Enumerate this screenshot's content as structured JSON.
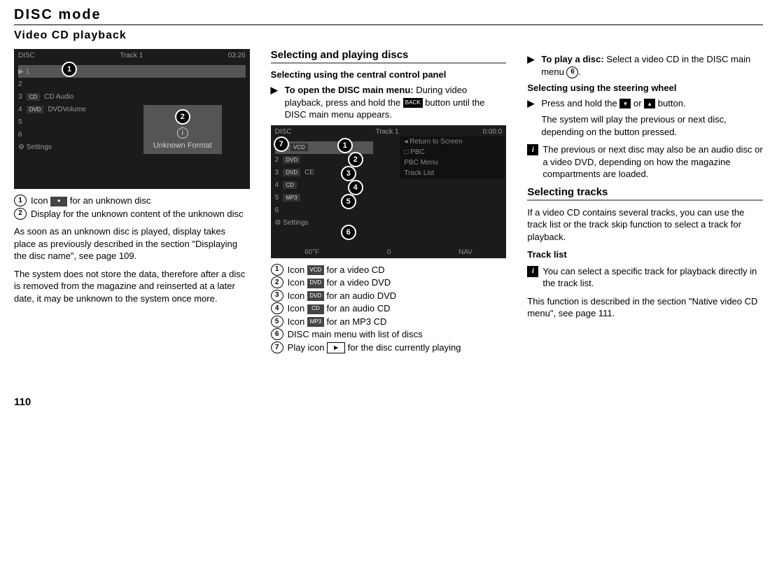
{
  "page_title": "DISC mode",
  "subtitle": "Video CD playback",
  "page_number": "110",
  "col1": {
    "screen1": {
      "top_left": "DISC",
      "top_mid": "Track 1",
      "top_right": "03:26",
      "rows": [
        "1",
        "2",
        "3 CD Audio",
        "4 DVDVolume",
        "5",
        "6",
        "Settings"
      ],
      "panel_text": "Unknown Format",
      "badge1": "1",
      "badge2": "2",
      "info_icon": "i"
    },
    "cap1_num": "1",
    "cap1_a": "Icon ",
    "cap1_b": " for an unknown disc",
    "cap2_num": "2",
    "cap2": "Display for the unknown content of the unknown disc",
    "p1": "As soon as an unknown disc is played, display takes place as previously described in the section \"Displaying the disc name\", see page 109.",
    "p2": "The system does not store the data, therefore after a disc is removed from the magazine and reinserted at a later date, it may be unknown to the system once more."
  },
  "col2": {
    "h1": "Selecting and playing discs",
    "h2": "Selecting using the central control panel",
    "step1_bold": "To open the DISC main menu:",
    "step1_a": " During video playback, press and hold the ",
    "step1_btn": "BACK",
    "step1_b": " button until the DISC main menu appears.",
    "screen2": {
      "top_left": "DISC",
      "top_mid": "Track 1",
      "top_right": "0:00:0",
      "row1": "1",
      "row2": "2 DVD",
      "row3": "3 DVD CD",
      "row4": "4 CD",
      "row5": "5 MP3",
      "row6": "6",
      "row7": "Settings",
      "sub1": "Return to Screen",
      "sub2": "PBC",
      "sub3": "PBC Menu",
      "sub4": "Track List",
      "bottom_left": "60°F",
      "bottom_mid": "0",
      "bottom_right": "NAV",
      "b1": "1",
      "b2": "2",
      "b3": "3",
      "b4": "4",
      "b5": "5",
      "b6": "6",
      "b7": "7"
    },
    "cap": {
      "n1": "1",
      "t1a": "Icon ",
      "t1b": " for a video CD",
      "i1": "VCD",
      "n2": "2",
      "t2a": "Icon ",
      "t2b": " for a video DVD",
      "i2": "DVD",
      "n3": "3",
      "t3a": "Icon ",
      "t3b": " for an audio DVD",
      "i3": "DVD",
      "n4": "4",
      "t4a": "Icon ",
      "t4b": " for an audio CD",
      "i4": "CD",
      "n5": "5",
      "t5a": "Icon ",
      "t5b": " for an MP3 CD",
      "i5": "MP3",
      "n6": "6",
      "t6": "DISC main menu with list of discs",
      "n7": "7",
      "t7a": "Play icon ",
      "t7b": " for the disc currently playing",
      "i7": "▶"
    }
  },
  "col3": {
    "step1_bold": "To play a disc:",
    "step1_a": " Select a video CD in the DISC main menu ",
    "step1_num": "6",
    "h2": "Selecting using the steering wheel",
    "step2_a": "Press and hold the ",
    "step2_b": " or ",
    "step2_c": " button.",
    "step2_body": "The system will play the previous or next disc, depending on the button pressed.",
    "info1": "The previous or next disc may also be an audio disc or a video DVD, depending on how the magazine compartments are loaded.",
    "h3": "Selecting tracks",
    "p1": "If a video CD contains several tracks, you can use the track list or the track skip function to select a track for playback.",
    "h4": "Track list",
    "info2": "You can select a specific track for playback directly in the track list.",
    "p2": "This function is described in the section \"Native video CD menu\", see page 111."
  }
}
